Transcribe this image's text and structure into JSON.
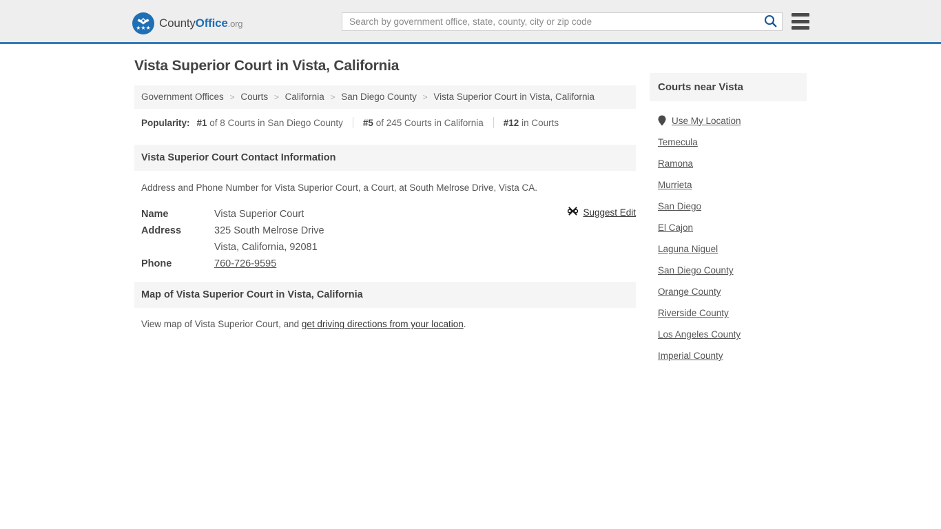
{
  "header": {
    "logo": {
      "part1": "County",
      "part2": "Office",
      "part3": ".org",
      "icon": "eagle-seal-icon",
      "stars": "★★★"
    },
    "search": {
      "placeholder": "Search by government office, state, county, city or zip code",
      "value": "",
      "search_icon": "search-icon"
    },
    "menu_icon": "hamburger-menu-icon",
    "accent_color": "#337ab7",
    "background_color": "#eeeeee"
  },
  "main": {
    "page_title": "Vista Superior Court in Vista, California",
    "breadcrumb": [
      {
        "label": "Government Offices",
        "link": true
      },
      {
        "label": "Courts",
        "link": true
      },
      {
        "label": "California",
        "link": true
      },
      {
        "label": "San Diego County",
        "link": true
      },
      {
        "label": "Vista Superior Court in Vista, California",
        "link": false
      }
    ],
    "breadcrumb_separator": ">",
    "popularity": {
      "label": "Popularity:",
      "items": [
        {
          "rank": "#1",
          "rest": " of 8 Courts in San Diego County"
        },
        {
          "rank": "#5",
          "rest": " of 245 Courts in California"
        },
        {
          "rank": "#12",
          "rest": " in Courts"
        }
      ]
    },
    "contact_section": {
      "heading": "Vista Superior Court Contact Information",
      "description": "Address and Phone Number for Vista Superior Court, a Court, at South Melrose Drive, Vista CA.",
      "suggest_edit": {
        "label": "Suggest Edit",
        "icon": "edit-suggest-icon"
      },
      "rows": [
        {
          "label": "Name",
          "value": "Vista Superior Court",
          "link": false
        },
        {
          "label": "Address",
          "value": "325 South Melrose Drive",
          "link": false
        },
        {
          "label": "",
          "value": "Vista, California, 92081",
          "link": false
        },
        {
          "label": "Phone",
          "value": "760-726-9595",
          "link": true
        }
      ]
    },
    "map_section": {
      "heading": "Map of Vista Superior Court in Vista, California",
      "text_before": "View map of Vista Superior Court, and ",
      "link_text": "get driving directions from your location",
      "text_after": "."
    }
  },
  "sidebar": {
    "heading": "Courts near Vista",
    "use_my_location": {
      "label": "Use My Location",
      "icon": "map-pin-icon"
    },
    "items": [
      {
        "label": "Temecula"
      },
      {
        "label": "Ramona"
      },
      {
        "label": "Murrieta"
      },
      {
        "label": "San Diego"
      },
      {
        "label": "El Cajon"
      },
      {
        "label": "Laguna Niguel"
      },
      {
        "label": "San Diego County"
      },
      {
        "label": "Orange County"
      },
      {
        "label": "Riverside County"
      },
      {
        "label": "Los Angeles County"
      },
      {
        "label": "Imperial County"
      }
    ]
  }
}
